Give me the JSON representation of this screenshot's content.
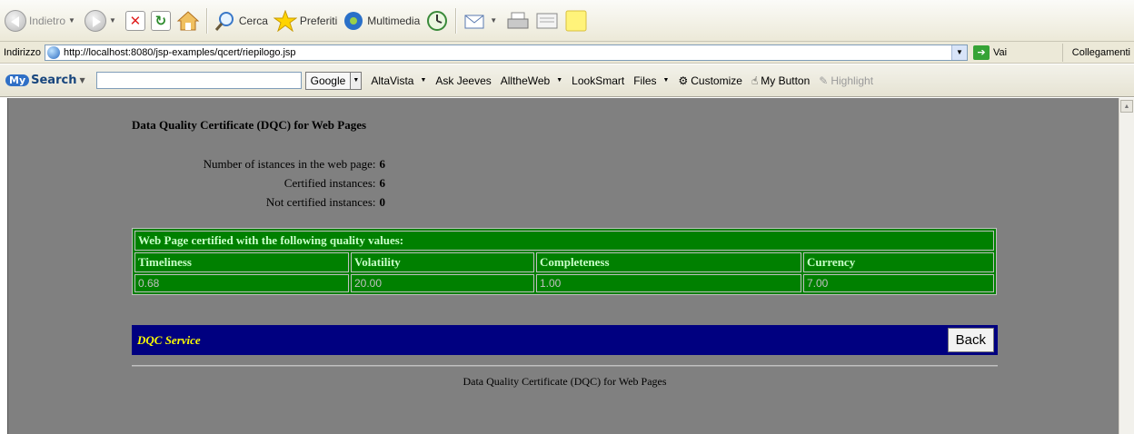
{
  "toolbar": {
    "back_label": "Indietro",
    "search_label": "Cerca",
    "favorites_label": "Preferiti",
    "media_label": "Multimedia"
  },
  "address": {
    "label": "Indirizzo",
    "url": "http://localhost:8080/jsp-examples/qcert/riepilogo.jsp",
    "go_label": "Vai",
    "links_label": "Collegamenti"
  },
  "searchbar": {
    "logo_my": "My",
    "logo_search": "Search",
    "query": "",
    "engine": "Google",
    "links": [
      "AltaVista",
      "Ask Jeeves",
      "AlltheWeb",
      "LookSmart",
      "Files"
    ],
    "customize": "Customize",
    "my_button": "My Button",
    "highlight": "Highlight"
  },
  "page": {
    "title": "Data Quality Certificate (DQC) for Web Pages",
    "counts": [
      {
        "label": "Number of istances in the web page:",
        "value": "6"
      },
      {
        "label": "Certified instances:",
        "value": "6"
      },
      {
        "label": "Not certified instances:",
        "value": "0"
      }
    ],
    "table": {
      "caption": "Web Page certified with the following quality values:",
      "headers": [
        "Timeliness",
        "Volatility",
        "Completeness",
        "Currency"
      ],
      "values": [
        "0.68",
        "20.00",
        "1.00",
        "7.00"
      ]
    },
    "service_label": "DQC Service",
    "back_button": "Back",
    "footer": "Data Quality Certificate (DQC) for Web Pages"
  },
  "colors": {
    "page_bg": "#808080",
    "table_bg": "#008000",
    "footbar_bg": "#000080",
    "service_text": "#ffff00"
  }
}
